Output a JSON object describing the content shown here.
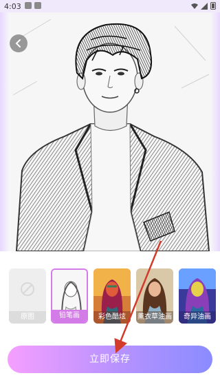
{
  "status_bar": {
    "time": "4:03"
  },
  "back_button": {
    "icon": "chevron-left-icon"
  },
  "styles": [
    {
      "label": "原图"
    },
    {
      "label": "铅笔画",
      "selected": true
    },
    {
      "label": "彩色酷炫"
    },
    {
      "label": "薰衣草油画"
    },
    {
      "label": "奇异油画"
    }
  ],
  "save_button": {
    "label": "立即保存"
  },
  "colors": {
    "accent": "#d37be6",
    "button_left": "#f59fff",
    "button_right": "#8a8cff",
    "arrow": "#d23a2b"
  }
}
